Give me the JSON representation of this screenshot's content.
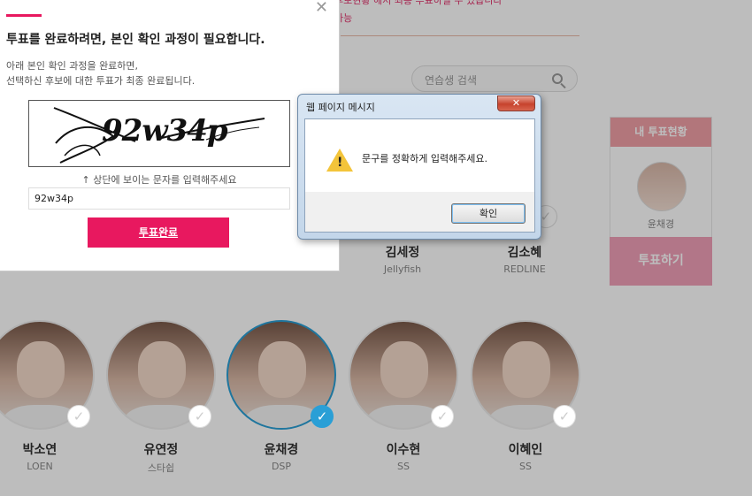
{
  "background": {
    "top_note": "후보현황 해서 최종 투표하실 수 있습니다",
    "top_note2": "가능",
    "search_placeholder": "연습생 검색",
    "vote_status": {
      "header": "내 투표현황",
      "selected_name": "윤채경",
      "vote_button": "투표하기"
    },
    "candidates_top": [
      {
        "name": "김세정",
        "agency": "Jellyfish"
      },
      {
        "name": "김소혜",
        "agency": "REDLINE"
      }
    ],
    "candidates_bottom": [
      {
        "name": "박소연",
        "agency": "LOEN",
        "selected": false
      },
      {
        "name": "유연정",
        "agency": "스타쉽",
        "selected": false
      },
      {
        "name": "윤채경",
        "agency": "DSP",
        "selected": true
      },
      {
        "name": "이수현",
        "agency": "SS",
        "selected": false
      },
      {
        "name": "이혜인",
        "agency": "SS",
        "selected": false
      }
    ]
  },
  "popup": {
    "close": "✕",
    "title": "투표를 완료하려면, 본인 확인 과정이 필요합니다.",
    "desc_line1": "아래 본인 확인 과정을 완료하면,",
    "desc_line2": "선택하신 후보에 대한 투표가 최종 완료됩니다.",
    "captcha_text": "92w34p",
    "hint": "↑ 상단에 보이는 문자를 입력해주세요",
    "answer_value": "92w34p",
    "submit_label": "투표완료"
  },
  "dialog": {
    "title": "웹 페이지 메시지",
    "close_label": "✕",
    "message": "문구를 정확하게 입력해주세요.",
    "ok_label": "확인"
  },
  "colors": {
    "accent": "#e8185f",
    "selected_ring": "#2a9fd6"
  }
}
